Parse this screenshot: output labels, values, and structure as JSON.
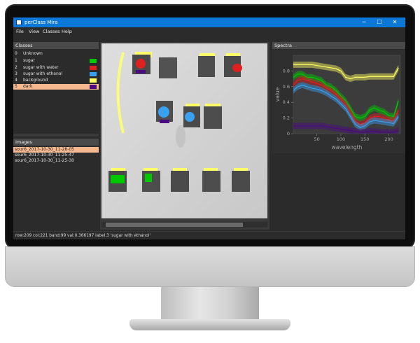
{
  "window": {
    "title": "perClass Mira",
    "controls": [
      "─",
      "☐",
      "✕"
    ]
  },
  "menu": {
    "items": [
      "File",
      "View",
      "Classes",
      "Help"
    ]
  },
  "classes_panel": {
    "title": "Classes",
    "items": [
      {
        "num": "0",
        "name": "Unknown",
        "color": ""
      },
      {
        "num": "1",
        "name": "sugar",
        "color": "#00c800"
      },
      {
        "num": "2",
        "name": "sugar with water",
        "color": "#e02020"
      },
      {
        "num": "3",
        "name": "sugar with ethanol",
        "color": "#3aa0f0"
      },
      {
        "num": "4",
        "name": "background",
        "color": "#ffff60"
      },
      {
        "num": "5",
        "name": "dark",
        "color": "#4a0a80"
      }
    ],
    "selected": 5
  },
  "images_panel": {
    "title": "Images",
    "items": [
      "sour6_2017-10-30_11-28-05",
      "sour6_2017-10-30_11-25-47",
      "sour6_2017-10-30_11-25-30"
    ],
    "selected": 0
  },
  "spectra_panel": {
    "title": "Spectra"
  },
  "status": {
    "text": "row:209 col:221 band:99 val:0.366197 label:3 'sugar with ethanol'"
  },
  "chart_data": {
    "type": "line",
    "title": "Spectra",
    "xlabel": "wavelength",
    "ylabel": "value",
    "xlim": [
      1,
      224
    ],
    "ylim": [
      0,
      1.0
    ],
    "xticks": [
      50,
      100,
      150,
      200
    ],
    "yticks": [
      0,
      0.2,
      0.4,
      0.6,
      0.8
    ],
    "x": [
      1,
      10,
      20,
      30,
      40,
      50,
      60,
      70,
      80,
      90,
      100,
      110,
      120,
      130,
      140,
      150,
      160,
      170,
      180,
      190,
      200,
      210,
      220
    ],
    "series": [
      {
        "color": "#ffff60",
        "values": [
          0.88,
          0.88,
          0.88,
          0.88,
          0.88,
          0.87,
          0.86,
          0.85,
          0.84,
          0.83,
          0.8,
          0.72,
          0.7,
          0.72,
          0.72,
          0.72,
          0.73,
          0.73,
          0.73,
          0.73,
          0.73,
          0.73,
          0.84
        ]
      },
      {
        "color": "#00c800",
        "values": [
          0.72,
          0.76,
          0.76,
          0.72,
          0.72,
          0.7,
          0.68,
          0.62,
          0.6,
          0.55,
          0.48,
          0.42,
          0.32,
          0.22,
          0.2,
          0.22,
          0.3,
          0.33,
          0.3,
          0.28,
          0.23,
          0.22,
          0.42
        ]
      },
      {
        "color": "#e02020",
        "values": [
          0.62,
          0.68,
          0.7,
          0.68,
          0.66,
          0.64,
          0.62,
          0.58,
          0.55,
          0.5,
          0.44,
          0.38,
          0.28,
          0.16,
          0.12,
          0.14,
          0.2,
          0.22,
          0.22,
          0.2,
          0.18,
          0.17,
          0.3
        ]
      },
      {
        "color": "#3aa0f0",
        "values": [
          0.55,
          0.6,
          0.62,
          0.6,
          0.58,
          0.57,
          0.55,
          0.52,
          0.48,
          0.44,
          0.38,
          0.32,
          0.22,
          0.12,
          0.08,
          0.1,
          0.15,
          0.17,
          0.16,
          0.15,
          0.14,
          0.13,
          0.22
        ]
      },
      {
        "color": "#4a0a80",
        "values": [
          0.1,
          0.1,
          0.1,
          0.1,
          0.1,
          0.1,
          0.1,
          0.09,
          0.08,
          0.07,
          0.06,
          0.05,
          0.04,
          0.03,
          0.02,
          0.02,
          0.03,
          0.03,
          0.02,
          0.02,
          0.02,
          0.02,
          0.04
        ]
      }
    ]
  }
}
